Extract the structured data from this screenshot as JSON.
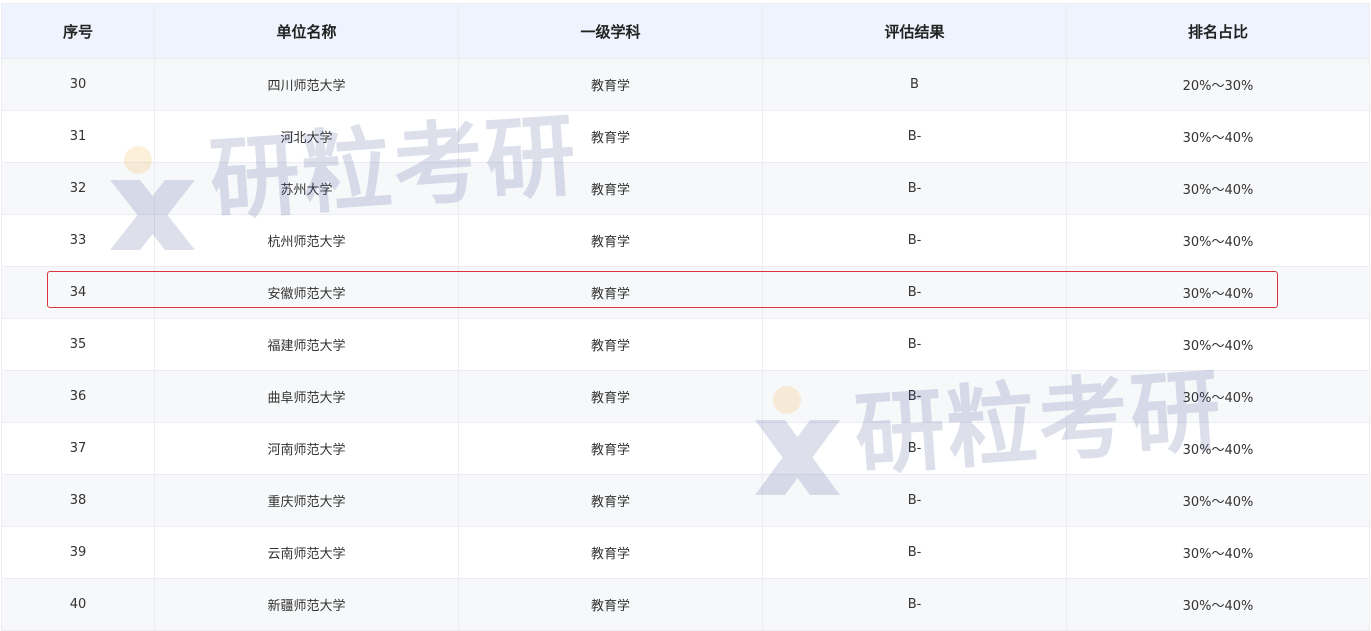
{
  "table": {
    "headers": [
      "序号",
      "单位名称",
      "一级学科",
      "评估结果",
      "排名占比"
    ],
    "rows": [
      [
        "30",
        "四川师范大学",
        "教育学",
        "B",
        "20%～30%"
      ],
      [
        "31",
        "河北大学",
        "教育学",
        "B-",
        "30%～40%"
      ],
      [
        "32",
        "苏州大学",
        "教育学",
        "B-",
        "30%～40%"
      ],
      [
        "33",
        "杭州师范大学",
        "教育学",
        "B-",
        "30%～40%"
      ],
      [
        "34",
        "安徽师范大学",
        "教育学",
        "B-",
        "30%～40%"
      ],
      [
        "35",
        "福建师范大学",
        "教育学",
        "B-",
        "30%～40%"
      ],
      [
        "36",
        "曲阜师范大学",
        "教育学",
        "B-",
        "30%～40%"
      ],
      [
        "37",
        "河南师范大学",
        "教育学",
        "B-",
        "30%～40%"
      ],
      [
        "38",
        "重庆师范大学",
        "教育学",
        "B-",
        "30%～40%"
      ],
      [
        "39",
        "云南师范大学",
        "教育学",
        "B-",
        "30%～40%"
      ],
      [
        "40",
        "新疆师范大学",
        "教育学",
        "B-",
        "30%～40%"
      ]
    ]
  },
  "highlight": {
    "row_index": 4,
    "color": "#d9363e"
  },
  "watermark": {
    "text": "研粒考研",
    "icon": "x-logo-icon",
    "color": "#30408a",
    "accent": "#f5a623"
  },
  "colors": {
    "header_bg": "#eef3fd",
    "row_alt_bg": "#f7f8fa",
    "border": "#ececf1"
  }
}
